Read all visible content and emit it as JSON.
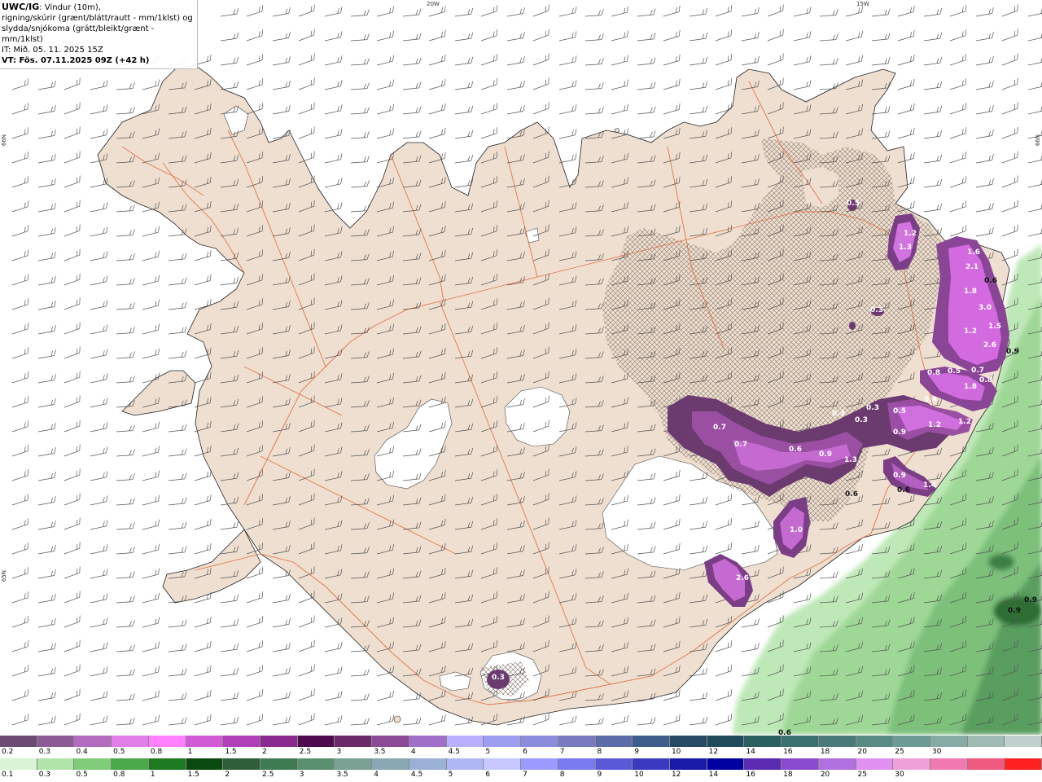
{
  "header": {
    "model": "UWC/IG",
    "line1": ": Vindur (10m),",
    "line2": "rigning/skúrir (grænt/blátt/rautt - mm/1klst) og",
    "line3": "slydda/snjókoma (grátt/bleikt/grænt - mm/1klst)",
    "line4": "IT: Mið. 05. 11. 2025 15Z",
    "line5": "VT: Fös. 07.11.2025 09Z (+42 h)"
  },
  "graticule": {
    "lon_20w": "20W",
    "lon_15w": "15W",
    "lat_66n_left": "66N",
    "lat_66n_right": "66N",
    "lat_65n_left": "65N"
  },
  "precip_labels": [
    {
      "v": "1.2"
    },
    {
      "v": "1.3"
    },
    {
      "v": "0.5"
    },
    {
      "v": "1.6"
    },
    {
      "v": "2.1"
    },
    {
      "v": "0.6"
    },
    {
      "v": "1.8"
    },
    {
      "v": "3.0"
    },
    {
      "v": "1.5"
    },
    {
      "v": "1.2"
    },
    {
      "v": "2.6"
    },
    {
      "v": "0.9"
    },
    {
      "v": "0.3"
    },
    {
      "v": "0.8"
    },
    {
      "v": "0.5"
    },
    {
      "v": "0.7"
    },
    {
      "v": "0.8"
    },
    {
      "v": "1.8"
    },
    {
      "v": "0.4"
    },
    {
      "v": "0.3"
    },
    {
      "v": "0.3"
    },
    {
      "v": "0.3"
    },
    {
      "v": "0.5"
    },
    {
      "v": "1.2"
    },
    {
      "v": "1.2"
    },
    {
      "v": "0.9"
    },
    {
      "v": "0.7"
    },
    {
      "v": "0.7"
    },
    {
      "v": "0.6"
    },
    {
      "v": "0.9"
    },
    {
      "v": "1.3"
    },
    {
      "v": "0.9"
    },
    {
      "v": "1.4"
    },
    {
      "v": "0.6"
    },
    {
      "v": "0.6"
    },
    {
      "v": "1.0"
    },
    {
      "v": "2.6"
    },
    {
      "v": "0.3"
    },
    {
      "v": "0.9"
    },
    {
      "v": "0.9"
    },
    {
      "v": "0.6"
    }
  ],
  "colorbar_snow": {
    "colors": [
      "#6b4a73",
      "#8c5a94",
      "#b36bbf",
      "#e07fe8",
      "#ff80ff",
      "#d15bd6",
      "#b040b8",
      "#8a2a8f",
      "#4d0a4d",
      "#6a2a6a",
      "#8a4a96",
      "#a070c8",
      "#b8b0ff",
      "#9e9ef0",
      "#8c8cdc",
      "#7a7ac0",
      "#5c6ca8",
      "#3e5c8c",
      "#274a64",
      "#1e4a5a",
      "#2a6060",
      "#3a7070",
      "#4a7a78",
      "#5a8a84",
      "#6e9a94",
      "#86aaa4",
      "#a0bab4",
      "#c0d0cc"
    ],
    "labels": [
      "0.2",
      "0.3",
      "0.4",
      "0.5",
      "0.8",
      "1",
      "1.5",
      "2",
      "2.5",
      "3",
      "3.5",
      "4",
      "4.5",
      "5",
      "6",
      "7",
      "8",
      "9",
      "10",
      "12",
      "14",
      "16",
      "18",
      "20",
      "25",
      "30",
      "",
      ""
    ]
  },
  "colorbar_rain": {
    "colors": [
      "#d8f4d4",
      "#b0e4a8",
      "#80cc78",
      "#4aa848",
      "#1e7a20",
      "#0a4a10",
      "#2e5e3a",
      "#3e7a52",
      "#5a9070",
      "#7aa094",
      "#8aa8b4",
      "#9ab0d4",
      "#b0b8f4",
      "#c8c8ff",
      "#9a9aff",
      "#7a7af0",
      "#5a5ad8",
      "#3a3ac0",
      "#1a1aa8",
      "#0000a0",
      "#5a2ab0",
      "#8a4ad0",
      "#b070e0",
      "#e090f0",
      "#f0a0d8",
      "#f07ab0",
      "#f05a80",
      "#ff2020"
    ],
    "labels": [
      "0.1",
      "0.3",
      "0.5",
      "0.8",
      "1",
      "1.5",
      "2",
      "2.5",
      "3",
      "3.5",
      "4",
      "4.5",
      "5",
      "6",
      "7",
      "8",
      "9",
      "10",
      "12",
      "14",
      "16",
      "18",
      "20",
      "25",
      "30",
      "",
      "",
      ""
    ]
  }
}
